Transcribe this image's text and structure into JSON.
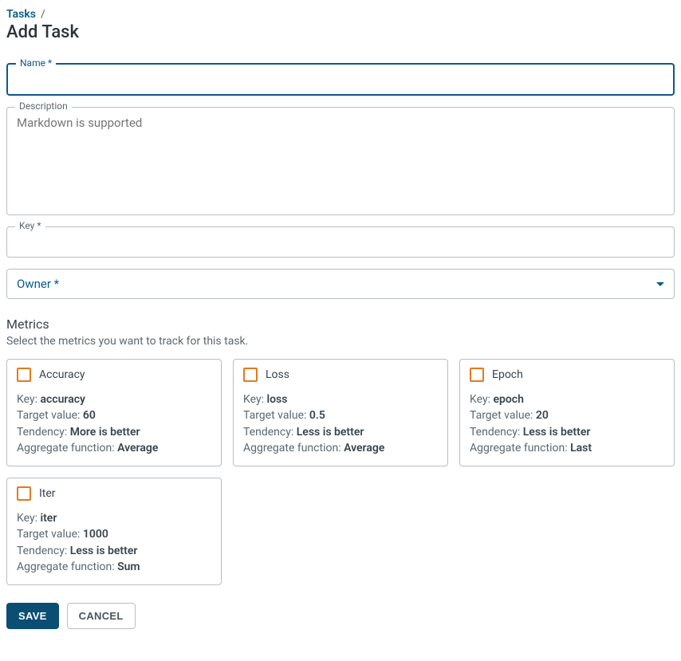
{
  "breadcrumb": {
    "root": "Tasks",
    "separator": "/"
  },
  "page_title": "Add Task",
  "fields": {
    "name": {
      "label": "Name *",
      "value": ""
    },
    "description": {
      "label": "Description",
      "placeholder": "Markdown is supported",
      "value": ""
    },
    "key": {
      "label": "Key *",
      "value": ""
    },
    "owner": {
      "label": "Owner *"
    }
  },
  "metrics_section": {
    "title": "Metrics",
    "subtitle": "Select the metrics you want to track for this task.",
    "labels": {
      "key": "Key:",
      "target": "Target value:",
      "tendency": "Tendency:",
      "agg": "Aggregate function:"
    },
    "items": [
      {
        "name": "Accuracy",
        "key": "accuracy",
        "target": "60",
        "tendency": "More is better",
        "agg": "Average"
      },
      {
        "name": "Loss",
        "key": "loss",
        "target": "0.5",
        "tendency": "Less is better",
        "agg": "Average"
      },
      {
        "name": "Epoch",
        "key": "epoch",
        "target": "20",
        "tendency": "Less is better",
        "agg": "Last"
      },
      {
        "name": "Iter",
        "key": "iter",
        "target": "1000",
        "tendency": "Less is better",
        "agg": "Sum"
      }
    ]
  },
  "buttons": {
    "save": "SAVE",
    "cancel": "CANCEL"
  }
}
